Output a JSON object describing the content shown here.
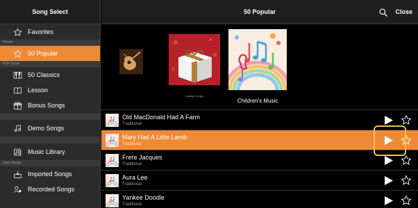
{
  "sidebar": {
    "title": "Song Select",
    "favorites": {
      "label": "Favorites",
      "icon": "star-outline-icon"
    },
    "preset_section": "Preset",
    "popular": {
      "label": "50 Popular",
      "icon": "star-outline-icon",
      "selected": true
    },
    "pdf_section": "PDF Score",
    "classics": {
      "label": "50 Classics",
      "icon": "piano-keys-icon"
    },
    "lesson": {
      "label": "Lesson",
      "icon": "lesson-book-icon"
    },
    "bonus": {
      "label": "Bonus Songs",
      "icon": "gift-icon"
    },
    "demo": {
      "label": "Demo Songs",
      "icon": "demo-note-icon"
    },
    "library": {
      "label": "Music Library",
      "icon": "music-library-icon"
    },
    "user_section": "User Songs",
    "imported": {
      "label": "Imported Songs",
      "icon": "import-icon"
    },
    "recorded": {
      "label": "Recorded Songs",
      "icon": "recorded-icon"
    }
  },
  "header": {
    "title": "50 Popular",
    "close_label": "Close",
    "search_icon": "search-icon"
  },
  "albums": [
    {
      "caption": "",
      "art": "guitar-album-art"
    },
    {
      "caption": "Holiday Songs",
      "art": "gift-box-album-art"
    },
    {
      "caption": "Children's Music",
      "art": "music-notes-album-art"
    }
  ],
  "songs": [
    {
      "name": "Old MacDonald Had A Farm",
      "composer": "Traditional",
      "selected": false
    },
    {
      "name": "Mary Had A Little Lamb",
      "composer": "Traditional",
      "selected": true
    },
    {
      "name": "Frere Jacques",
      "composer": "Traditional",
      "selected": false
    },
    {
      "name": "Aura Lee",
      "composer": "Traditional",
      "selected": false
    },
    {
      "name": "Yankee Doodle",
      "composer": "Traditional",
      "selected": false
    }
  ],
  "colors": {
    "accent": "#ee8a36",
    "highlight_box": "#f4c24a",
    "sidebar_bg": "#2b2b2b",
    "main_bg": "#000000"
  }
}
